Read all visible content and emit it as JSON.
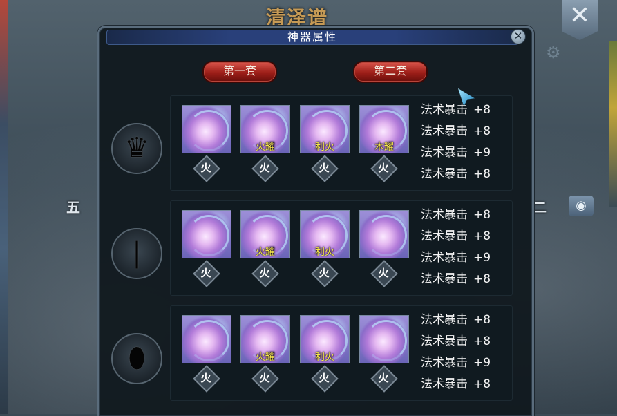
{
  "background": {
    "title": "清泽谱",
    "left_text": "五",
    "right_text": "二",
    "close_glyph": "✕",
    "eye_icon": "eye-icon"
  },
  "dialog": {
    "title": "神器属性",
    "close_glyph": "✕",
    "buttons": {
      "set1": "第一套",
      "set2": "第二套"
    },
    "rows": [
      {
        "slot_icon": "weapon-silhouette-icon",
        "gems": [
          {
            "label": "",
            "element": "火"
          },
          {
            "label": "火耀",
            "element": "火"
          },
          {
            "label": "利火",
            "element": "火"
          },
          {
            "label": "木耀",
            "element": "火"
          }
        ],
        "stats": [
          {
            "name": "法术暴击",
            "value": "+8"
          },
          {
            "name": "法术暴击",
            "value": "+8"
          },
          {
            "name": "法术暴击",
            "value": "+9"
          },
          {
            "name": "法术暴击",
            "value": "+8"
          }
        ]
      },
      {
        "slot_icon": "weapon-silhouette-icon",
        "gems": [
          {
            "label": "",
            "element": "火"
          },
          {
            "label": "火耀",
            "element": "火"
          },
          {
            "label": "利火",
            "element": "火"
          },
          {
            "label": "",
            "element": "火"
          }
        ],
        "stats": [
          {
            "name": "法术暴击",
            "value": "+8"
          },
          {
            "name": "法术暴击",
            "value": "+8"
          },
          {
            "name": "法术暴击",
            "value": "+9"
          },
          {
            "name": "法术暴击",
            "value": "+8"
          }
        ]
      },
      {
        "slot_icon": "weapon-silhouette-icon",
        "gems": [
          {
            "label": "",
            "element": "火"
          },
          {
            "label": "火耀",
            "element": "火"
          },
          {
            "label": "利火",
            "element": "火"
          },
          {
            "label": "",
            "element": "火"
          }
        ],
        "stats": [
          {
            "name": "法术暴击",
            "value": "+8"
          },
          {
            "name": "法术暴击",
            "value": "+8"
          },
          {
            "name": "法术暴击",
            "value": "+9"
          },
          {
            "name": "法术暴击",
            "value": "+8"
          }
        ]
      }
    ]
  }
}
